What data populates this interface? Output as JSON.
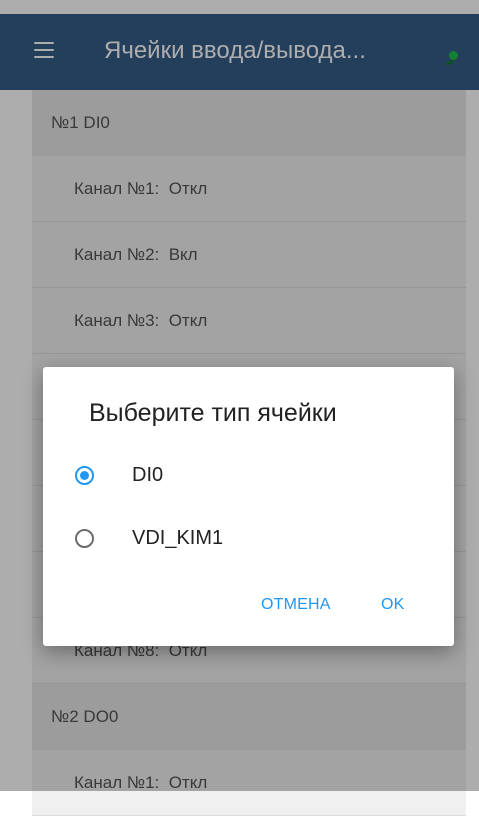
{
  "appbar": {
    "title": "Ячейки ввода/вывода..."
  },
  "list": {
    "groups": [
      {
        "header": "№1  DI0",
        "rows": [
          "Канал №1:  Откл",
          "Канал №2:  Вкл",
          "Канал №3:  Откл",
          "",
          "",
          "",
          "",
          "Канал №8:  Откл"
        ]
      },
      {
        "header": "№2  DO0",
        "rows": [
          "Канал №1:  Откл"
        ]
      }
    ]
  },
  "dialog": {
    "title": "Выберите тип ячейки",
    "options": [
      {
        "label": "DI0",
        "selected": true
      },
      {
        "label": "VDI_KIM1",
        "selected": false
      }
    ],
    "cancel_label": "ОТМЕНА",
    "ok_label": "OK"
  },
  "colors": {
    "appbar": "#355d87",
    "accent": "#2196f3",
    "status_indicator": "#1bbf4a"
  },
  "icons": {
    "menu": "hamburger-menu-icon",
    "status": "connection-status-icon"
  }
}
